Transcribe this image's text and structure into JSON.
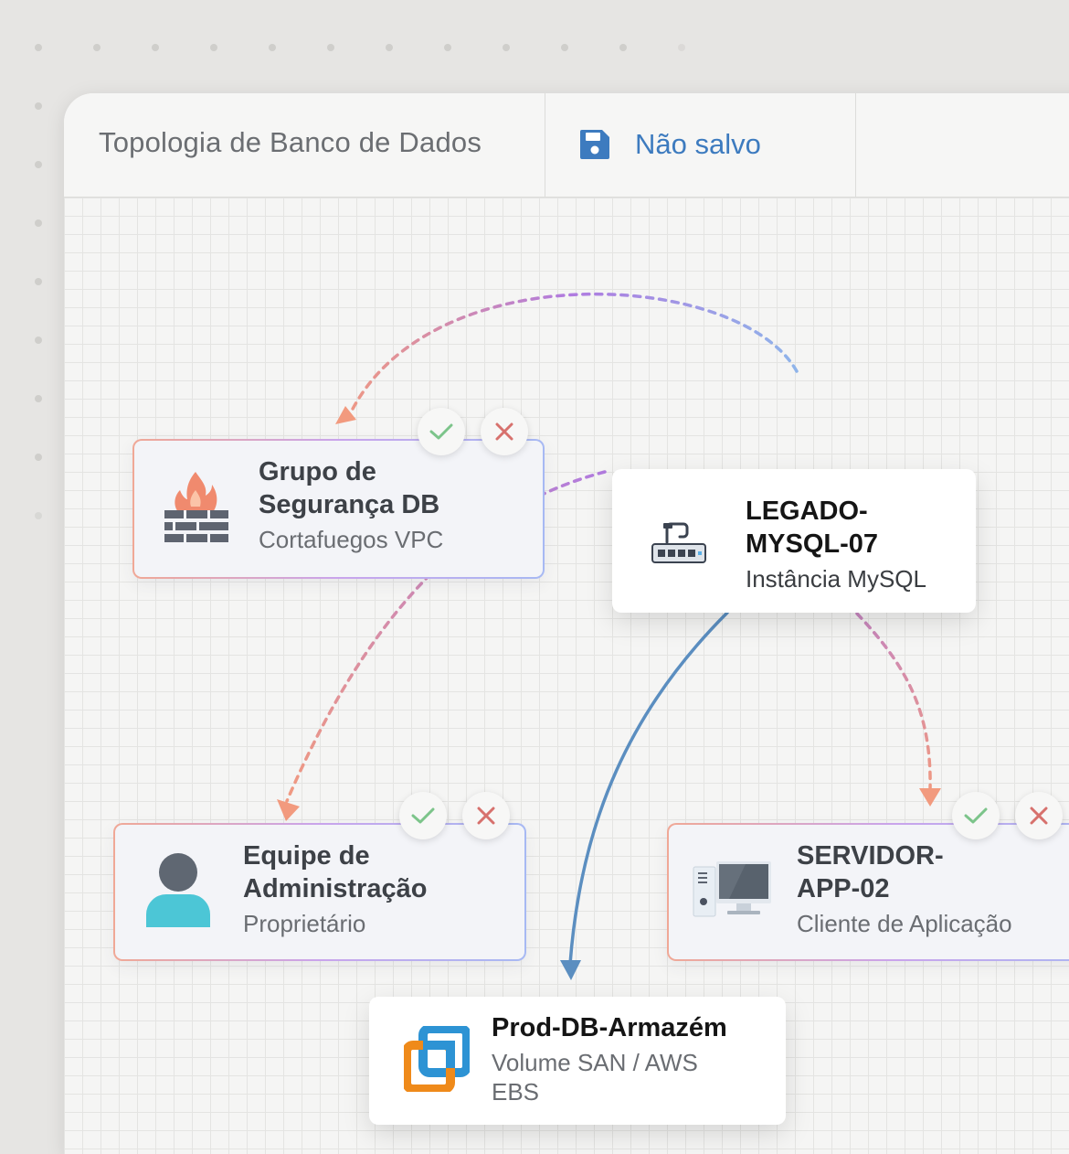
{
  "window": {
    "title": "Topologia de Banco de Dados"
  },
  "toolbar": {
    "save_status": "Não salvo",
    "save_icon": "floppy-disk-icon"
  },
  "nodes": {
    "security_group": {
      "title_line1": "Grupo de",
      "title_line2": "Segurança DB",
      "subtitle": "Cortafuegos VPC",
      "icon": "firewall-icon"
    },
    "legacy_mysql": {
      "title_line1": "LEGADO-",
      "title_line2": "MYSQL-07",
      "subtitle": "Instância MySQL",
      "icon": "router-icon"
    },
    "admin_team": {
      "title_line1": "Equipe de",
      "title_line2": "Administração",
      "subtitle": "Proprietário",
      "icon": "user-icon"
    },
    "app_server": {
      "title_line1": "SERVIDOR-",
      "title_line2": "APP-02",
      "subtitle": "Cliente de Aplicação",
      "icon": "desktop-computer-icon"
    },
    "prod_storage": {
      "title": "Prod-DB-Armazém",
      "subtitle_line1": "Volume SAN / AWS",
      "subtitle_line2": "EBS",
      "icon": "storage-volume-icon"
    }
  },
  "actions": {
    "accept_icon": "check-icon",
    "reject_icon": "close-icon"
  },
  "colors": {
    "accent_blue": "#3d7bbf",
    "edge_solid": "#5b8ec0",
    "edge_dashed_start": "#8fb4ea",
    "edge_dashed_mid": "#b07be0",
    "edge_dashed_end": "#f29a7e",
    "accept": "#7cc48a",
    "reject": "#d7716d"
  }
}
